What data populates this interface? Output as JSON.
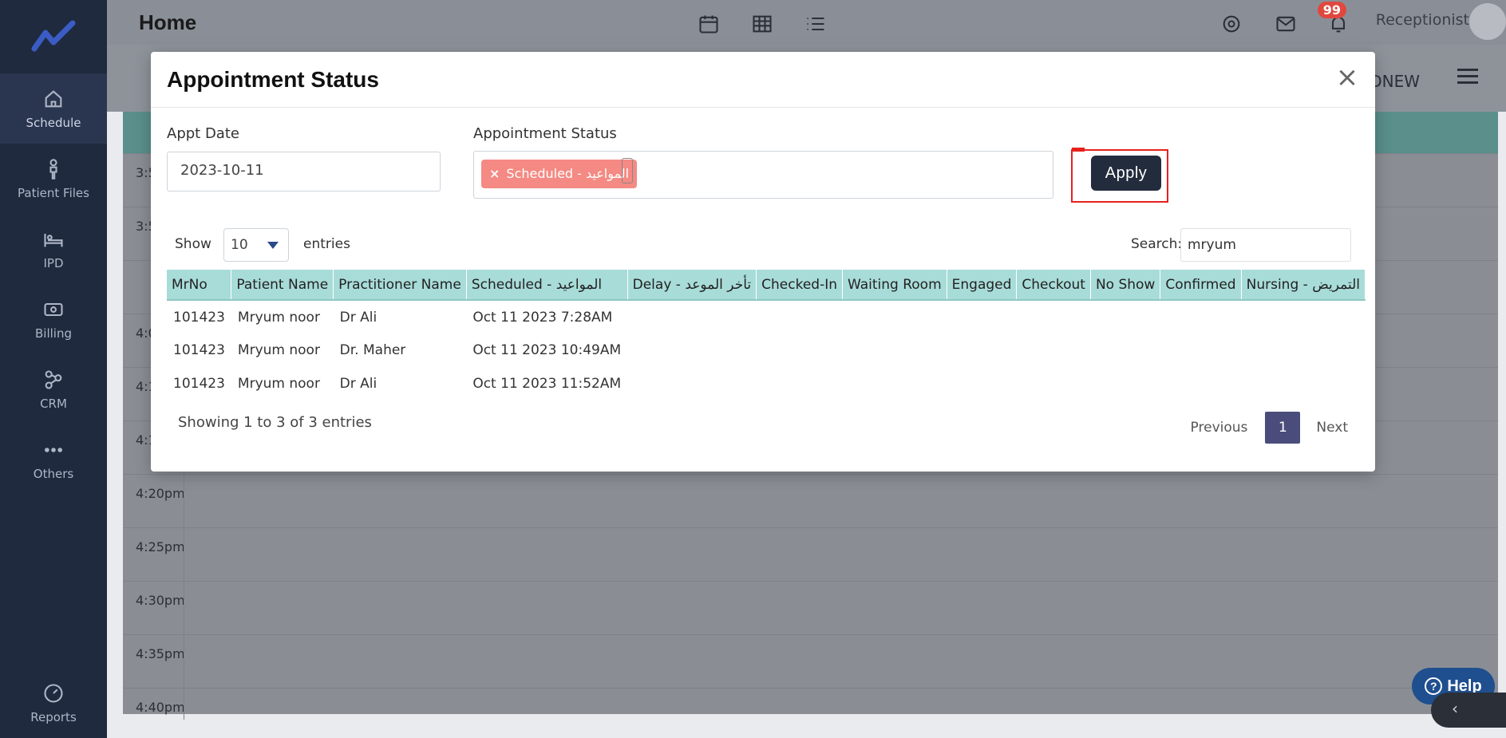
{
  "sidebar": {
    "items": [
      {
        "label": "Schedule",
        "icon": "home-icon"
      },
      {
        "label": "Patient Files",
        "icon": "person-icon"
      },
      {
        "label": "IPD",
        "icon": "bed-icon"
      },
      {
        "label": "Billing",
        "icon": "cash-icon"
      },
      {
        "label": "CRM",
        "icon": "network-icon"
      },
      {
        "label": "Others",
        "icon": "dots-icon"
      }
    ],
    "bottom": {
      "label": "Reports",
      "icon": "gauge-icon"
    }
  },
  "topbar": {
    "title": "Home",
    "role": "Receptionist",
    "notifications": "99",
    "subbar_chip": "ODNEW"
  },
  "background": {
    "times": [
      "3:5",
      "3:5",
      "",
      "4:0",
      "4:1",
      "4:1",
      "4:20pm",
      "4:25pm",
      "4:30pm",
      "4:35pm",
      "4:40pm"
    ]
  },
  "modal": {
    "title": "Appointment Status",
    "close_label": "×",
    "appt_date_label": "Appt Date",
    "appt_date_value": "2023-10-11",
    "status_label": "Appointment Status",
    "selected_tags": [
      {
        "label": "Scheduled - المواعيد",
        "remove": "×"
      }
    ],
    "apply_label": "Apply",
    "show_label": "Show",
    "entries_value": "10",
    "entries_label": "entries",
    "search_label": "Search:",
    "search_value": "mryum",
    "columns": [
      "MrNo",
      "Patient Name",
      "Practitioner Name",
      "Scheduled - المواعيد",
      "Delay - تأخر الموعد",
      "Checked-In",
      "Waiting Room",
      "Engaged",
      "Checkout",
      "No Show",
      "Confirmed",
      "Nursing - التمريض"
    ],
    "rows": [
      [
        "101423",
        "Mryum noor",
        "Dr Ali",
        "Oct 11 2023 7:28AM",
        "",
        "",
        "",
        "",
        "",
        "",
        "",
        ""
      ],
      [
        "101423",
        "Mryum noor",
        "Dr. Maher",
        "Oct 11 2023 10:49AM",
        "",
        "",
        "",
        "",
        "",
        "",
        "",
        ""
      ],
      [
        "101423",
        "Mryum noor",
        "Dr Ali",
        "Oct 11 2023 11:52AM",
        "",
        "",
        "",
        "",
        "",
        "",
        "",
        ""
      ]
    ],
    "info": "Showing 1 to 3 of 3 entries",
    "pagination": {
      "previous": "Previous",
      "current": "1",
      "next": "Next"
    }
  },
  "help": {
    "label": "Help",
    "glyph": "?"
  },
  "dock": {
    "glyph": "‹"
  }
}
